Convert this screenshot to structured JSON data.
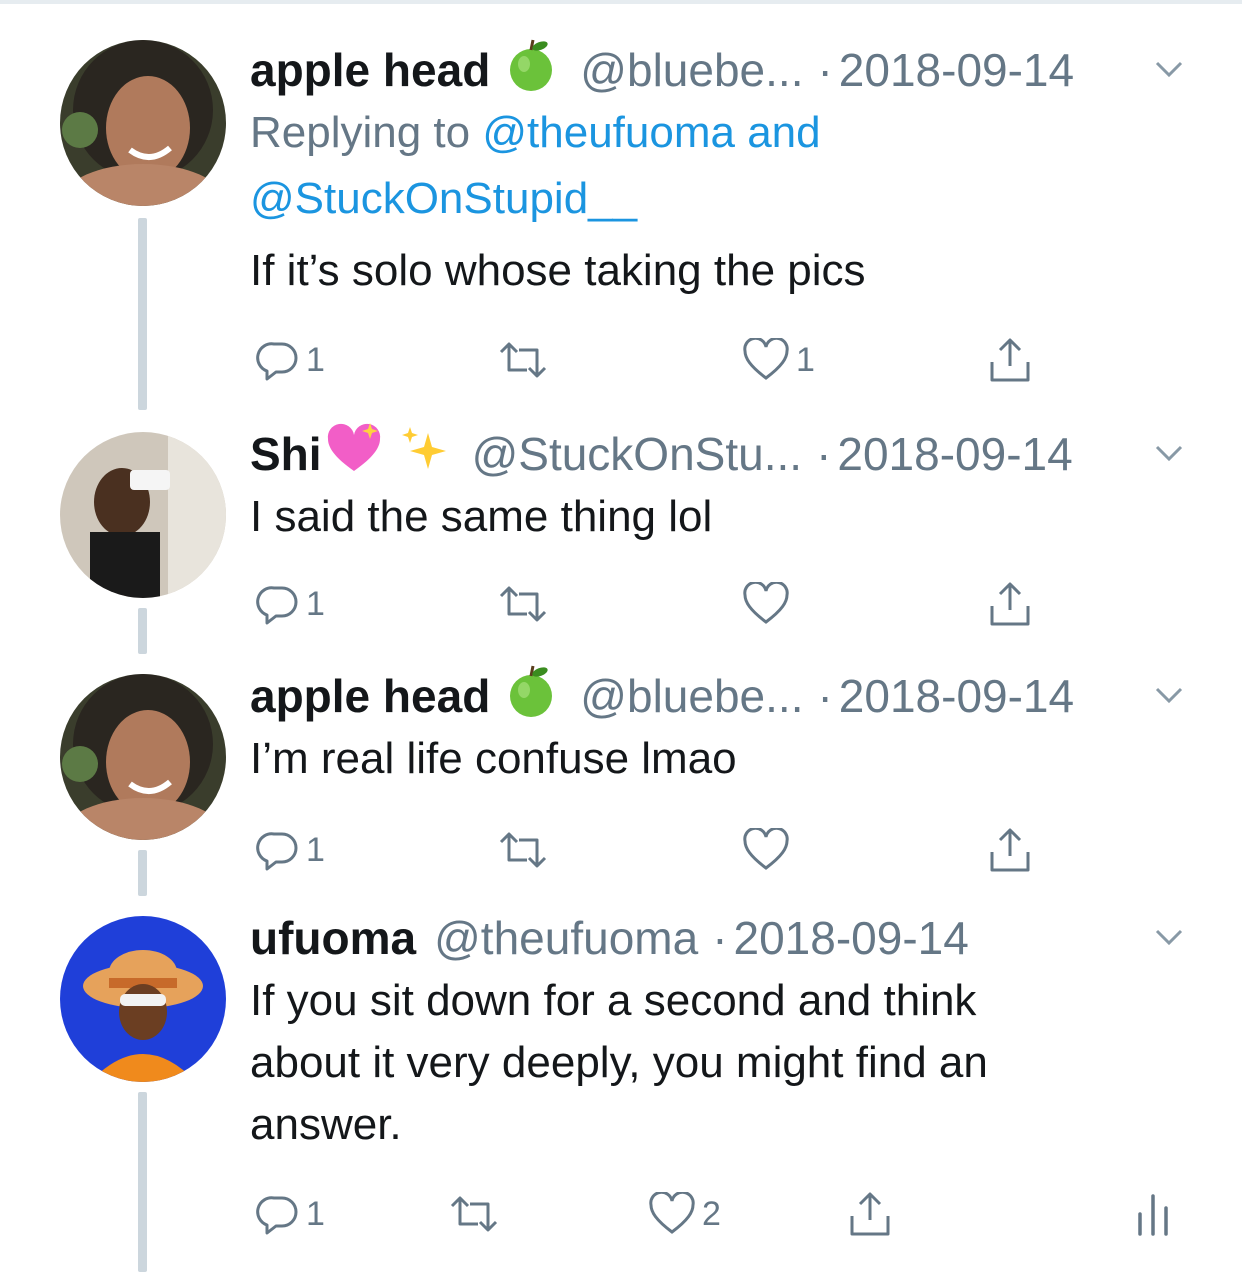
{
  "colors": {
    "link": "#1b95e0",
    "muted": "#657786",
    "thread_line": "#ccd6dd"
  },
  "tweets": [
    {
      "name": "apple head",
      "name_emoji": "green-apple-emoji",
      "handle": "@bluebe...",
      "date": "2018-09-14",
      "replying_prefix": "Replying to",
      "replying_links": [
        "@theufuoma",
        "and",
        "@StuckOnStupid__"
      ],
      "text": "If it’s solo whose taking the pics",
      "reply_count": "1",
      "like_count": "1"
    },
    {
      "name": "Shi",
      "name_emoji": "sparkling-heart-and-sparkles-emoji",
      "handle": "@StuckOnStu...",
      "date": "2018-09-14",
      "text": "I said the same thing lol",
      "reply_count": "1",
      "like_count": ""
    },
    {
      "name": "apple head",
      "name_emoji": "green-apple-emoji",
      "handle": "@bluebe...",
      "date": "2018-09-14",
      "text": "I’m real life confuse lmao",
      "reply_count": "1",
      "like_count": ""
    },
    {
      "name": "ufuoma",
      "handle": "@theufuoma",
      "date": "2018-09-14",
      "text_lines": [
        "If you sit down for a second and think",
        "about it very deeply, you might find an",
        "answer."
      ],
      "reply_count": "1",
      "like_count": "2"
    }
  ]
}
